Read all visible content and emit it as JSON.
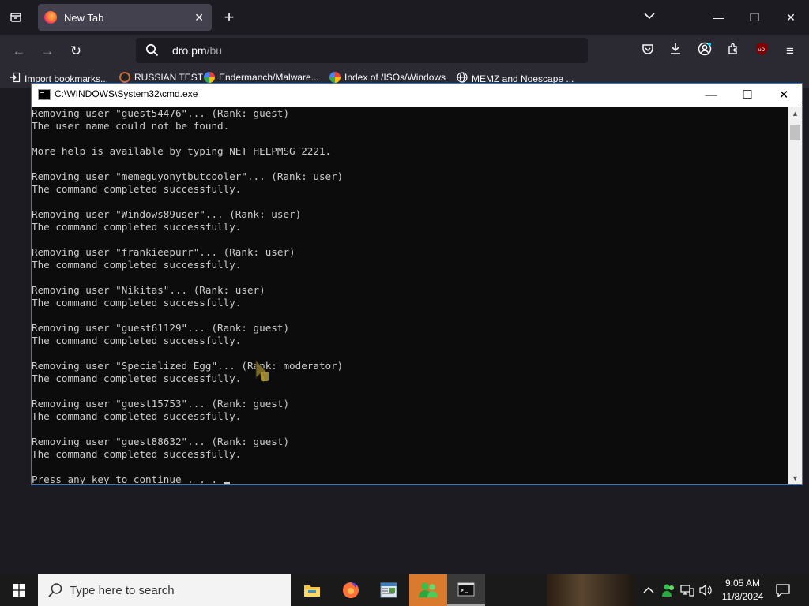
{
  "browser": {
    "tab": {
      "title": "New Tab"
    },
    "url": {
      "host": "dro.pm",
      "path": "/bu"
    },
    "bookmarks": [
      {
        "label": "Import bookmarks...",
        "icon": "import-icon"
      },
      {
        "label": "RUSSIAN TEST",
        "icon": "github-icon"
      },
      {
        "label": "Endermanch/Malware...",
        "icon": "google-icon"
      },
      {
        "label": "Index of /ISOs/Windows",
        "icon": "google-icon"
      },
      {
        "label": "MEMZ and Noescape ...",
        "icon": "globe-icon"
      }
    ],
    "ublock_badge": "uO"
  },
  "cmd": {
    "title": "C:\\WINDOWS\\System32\\cmd.exe",
    "lines": [
      "Removing user \"guest54476\"... (Rank: guest)",
      "The user name could not be found.",
      "",
      "More help is available by typing NET HELPMSG 2221.",
      "",
      "Removing user \"memeguyonytbutcooler\"... (Rank: user)",
      "The command completed successfully.",
      "",
      "Removing user \"Windows89user\"... (Rank: user)",
      "The command completed successfully.",
      "",
      "Removing user \"frankieepurr\"... (Rank: user)",
      "The command completed successfully.",
      "",
      "Removing user \"Nikitas\"... (Rank: user)",
      "The command completed successfully.",
      "",
      "Removing user \"guest61129\"... (Rank: guest)",
      "The command completed successfully.",
      "",
      "Removing user \"Specialized Egg\"... (Rank: moderator)",
      "The command completed successfully.",
      "",
      "Removing user \"guest15753\"... (Rank: guest)",
      "The command completed successfully.",
      "",
      "Removing user \"guest88632\"... (Rank: guest)",
      "The command completed successfully.",
      "",
      "Press any key to continue . . . "
    ]
  },
  "taskbar": {
    "search_placeholder": "Type here to search",
    "apps": [
      "file-explorer-icon",
      "firefox-icon",
      "notepad-icon",
      "msn-messenger-icon",
      "cmd-icon"
    ],
    "time": "9:05 AM",
    "date": "11/8/2024"
  },
  "colors": {
    "accent_taskbar_active": "#d97a2d",
    "console_text": "#cccccc",
    "console_bg": "#0c0c0c"
  }
}
